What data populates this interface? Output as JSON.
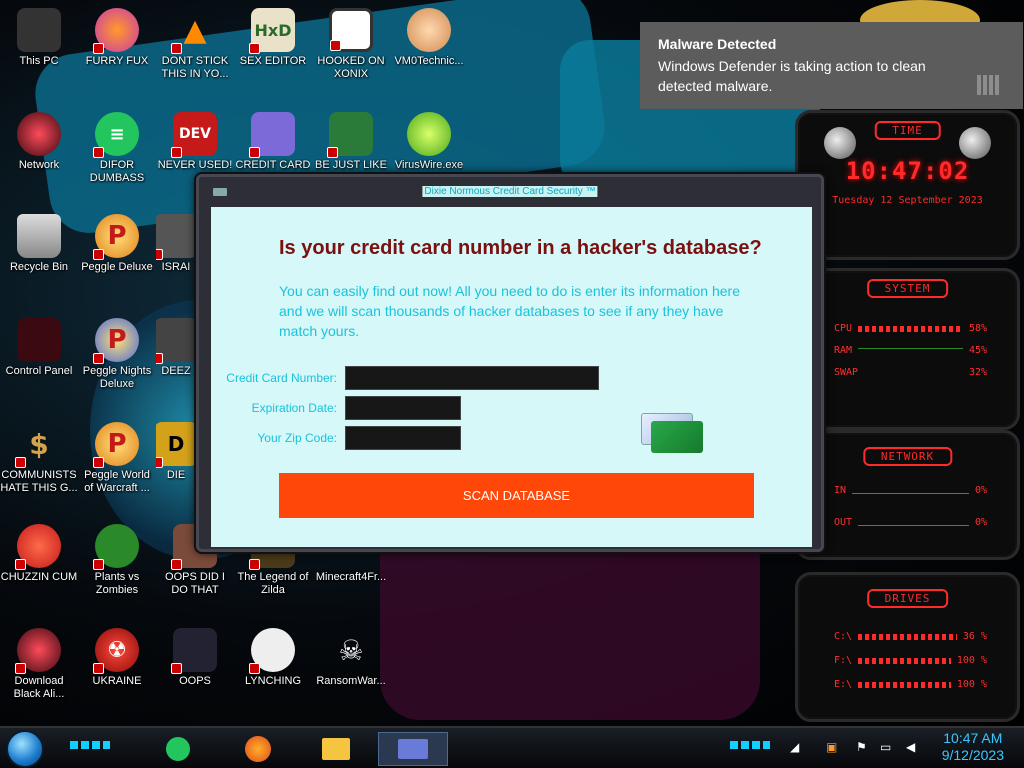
{
  "desktop": {
    "icons": [
      {
        "label": "This PC"
      },
      {
        "label": "FURRY FUX"
      },
      {
        "label": "DONT STICK THIS IN YO..."
      },
      {
        "label": "SEX EDITOR"
      },
      {
        "label": "HOOKED ON XONIX"
      },
      {
        "label": "VM0Technic..."
      },
      {
        "label": "Network"
      },
      {
        "label": "DIFOR DUMBASS"
      },
      {
        "label": "NEVER USED!"
      },
      {
        "label": "CREDIT CARD"
      },
      {
        "label": "BE JUST LIKE"
      },
      {
        "label": "VirusWire.exe"
      },
      {
        "label": "Recycle Bin"
      },
      {
        "label": "Peggle Deluxe"
      },
      {
        "label": "ISRAI"
      },
      {
        "label": "Control Panel"
      },
      {
        "label": "Peggle Nights Deluxe"
      },
      {
        "label": "DEEZ"
      },
      {
        "label": "COMMUNISTS HATE THIS G..."
      },
      {
        "label": "Peggle World of Warcraft ..."
      },
      {
        "label": "DIE"
      },
      {
        "label": "CHUZZIN CUM"
      },
      {
        "label": "Plants vs Zombies"
      },
      {
        "label": "OOPS DID I DO THAT"
      },
      {
        "label": "The Legend of Zilda"
      },
      {
        "label": "Minecraft4Fr..."
      },
      {
        "label": "Download Black Ali..."
      },
      {
        "label": "UKRAINE"
      },
      {
        "label": "OOPS"
      },
      {
        "label": "LYNCHING"
      },
      {
        "label": "RansomWar..."
      }
    ]
  },
  "notification": {
    "title": "Malware Detected",
    "body": "Windows Defender is taking action to clean detected malware."
  },
  "gadgets": {
    "time": {
      "title": "TIME",
      "clock": "10:47:02",
      "date": "Tuesday 12 September 2023"
    },
    "system": {
      "title": "SYSTEM",
      "rows": [
        {
          "label": "CPU",
          "value": "58%"
        },
        {
          "label": "RAM",
          "value": "45%"
        },
        {
          "label": "SWAP",
          "value": "32%"
        }
      ]
    },
    "network": {
      "title": "NETWORK",
      "rows": [
        {
          "label": "IN",
          "value": "0%"
        },
        {
          "label": "OUT",
          "value": "0%"
        }
      ]
    },
    "drives": {
      "title": "DRIVES",
      "rows": [
        {
          "label": "C:\\",
          "value": "36 %"
        },
        {
          "label": "F:\\",
          "value": "100 %"
        },
        {
          "label": "E:\\",
          "value": "100 %"
        }
      ]
    }
  },
  "window": {
    "title": "Dixie Normous Credit Card Security ™",
    "heading": "Is your credit card number in a hacker's database?",
    "description": "You can easily find out now! All you need to do is enter its information here and we will scan thousands of hacker databases to see if any they have match yours.",
    "fields": {
      "card_number_label": "Credit Card Number:",
      "card_number_value": "",
      "expiration_label": "Expiration Date:",
      "expiration_value": "",
      "zip_label": "Your Zip Code:",
      "zip_value": ""
    },
    "scan_button": "SCAN DATABASE"
  },
  "taskbar": {
    "time": "10:47 AM",
    "date": "9/12/2023"
  },
  "colors": {
    "accent_red": "#ff2a2a",
    "window_bg": "#d6f8f8",
    "heading": "#7a1010",
    "text_cyan": "#19c3dc",
    "button": "#fe4708",
    "clock_blue": "#3cc7ff"
  }
}
